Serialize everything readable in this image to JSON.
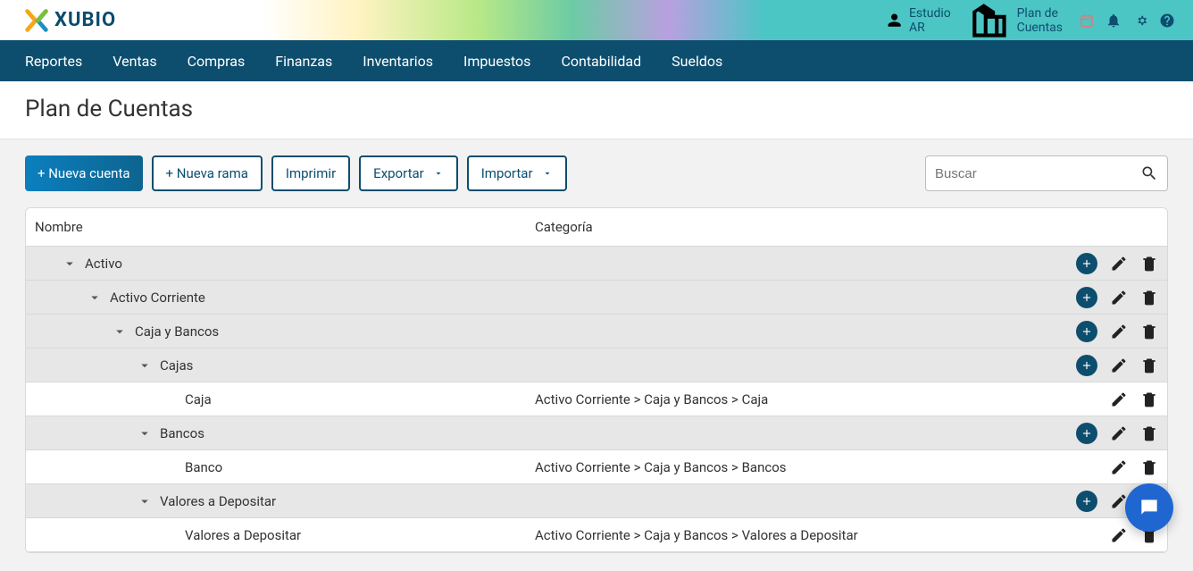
{
  "brand": {
    "name": "XUBIO"
  },
  "topbar": {
    "estudio_label": "Estudio AR",
    "plan_label": "Plan de Cuentas"
  },
  "nav": {
    "items": [
      {
        "label": "Reportes"
      },
      {
        "label": "Ventas"
      },
      {
        "label": "Compras"
      },
      {
        "label": "Finanzas"
      },
      {
        "label": "Inventarios"
      },
      {
        "label": "Impuestos"
      },
      {
        "label": "Contabilidad"
      },
      {
        "label": "Sueldos"
      }
    ]
  },
  "page": {
    "title": "Plan de Cuentas"
  },
  "toolbar": {
    "new_account": "+ Nueva cuenta",
    "new_branch": "+ Nueva rama",
    "print": "Imprimir",
    "export": "Exportar",
    "import": "Importar",
    "search_placeholder": "Buscar"
  },
  "table": {
    "headers": {
      "name": "Nombre",
      "category": "Categoría"
    },
    "rows": [
      {
        "type": "branch",
        "indent": 0,
        "name": "Activo",
        "category": "",
        "has_chevron": true
      },
      {
        "type": "branch",
        "indent": 1,
        "name": "Activo Corriente",
        "category": "",
        "has_chevron": true
      },
      {
        "type": "branch",
        "indent": 2,
        "name": "Caja y Bancos",
        "category": "",
        "has_chevron": true
      },
      {
        "type": "branch",
        "indent": 3,
        "name": "Cajas",
        "category": "",
        "has_chevron": true
      },
      {
        "type": "leaf",
        "indent": 4,
        "name": "Caja",
        "category": "Activo Corriente > Caja y Bancos > Caja",
        "has_chevron": false
      },
      {
        "type": "branch",
        "indent": 3,
        "name": "Bancos",
        "category": "",
        "has_chevron": true
      },
      {
        "type": "leaf",
        "indent": 4,
        "name": "Banco",
        "category": "Activo Corriente > Caja y Bancos > Bancos",
        "has_chevron": false
      },
      {
        "type": "branch",
        "indent": 3,
        "name": "Valores a Depositar",
        "category": "",
        "has_chevron": true
      },
      {
        "type": "leaf",
        "indent": 4,
        "name": "Valores a Depositar",
        "category": "Activo Corriente > Caja y Bancos > Valores a Depositar",
        "has_chevron": false
      }
    ]
  },
  "colors": {
    "brand_dark": "#0d4e6e",
    "fab": "#1f66d1"
  }
}
